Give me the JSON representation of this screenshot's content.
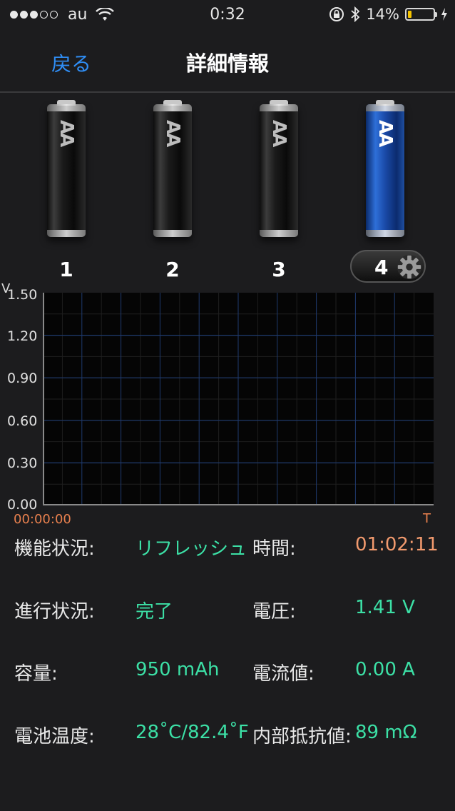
{
  "status": {
    "carrier": "au",
    "time": "0:32",
    "battery_pct": "14%",
    "battery_level": 0.14,
    "signal_bars": 3,
    "signal_total": 5
  },
  "nav": {
    "back_label": "戻る",
    "title": "詳細情報"
  },
  "slots": [
    {
      "label": "1",
      "type": "AA",
      "active": false
    },
    {
      "label": "2",
      "type": "AA",
      "active": false
    },
    {
      "label": "3",
      "type": "AA",
      "active": false
    },
    {
      "label": "4",
      "type": "AA",
      "active": true
    }
  ],
  "chart_data": {
    "type": "line",
    "ylabel": "V",
    "xlabel": "T",
    "x_start_label": "00:00:00",
    "y_ticks": [
      "1.50",
      "1.20",
      "0.90",
      "0.60",
      "0.30",
      "0.00"
    ],
    "ylim": [
      0,
      1.5
    ],
    "grid": true,
    "series": []
  },
  "info": {
    "function_label": "機能状況:",
    "function_value": "リフレッシュ",
    "time_label": "時間:",
    "time_value": "01:02:11",
    "progress_label": "進行状況:",
    "progress_value": "完了",
    "voltage_label": "電圧:",
    "voltage_value": "1.41 V",
    "capacity_label": "容量:",
    "capacity_value": "950 mAh",
    "current_label": "電流値:",
    "current_value": "0.00 A",
    "temp_label": "電池温度:",
    "temp_value": "28˚C/82.4˚F",
    "resistance_label": "内部抵抗値:",
    "resistance_value": "89 mΩ"
  },
  "colors": {
    "accent_blue": "#2f8ef6",
    "value_green": "#3ce0a6",
    "value_orange": "#f29a6e",
    "grid_blue": "#1f3a6e"
  }
}
